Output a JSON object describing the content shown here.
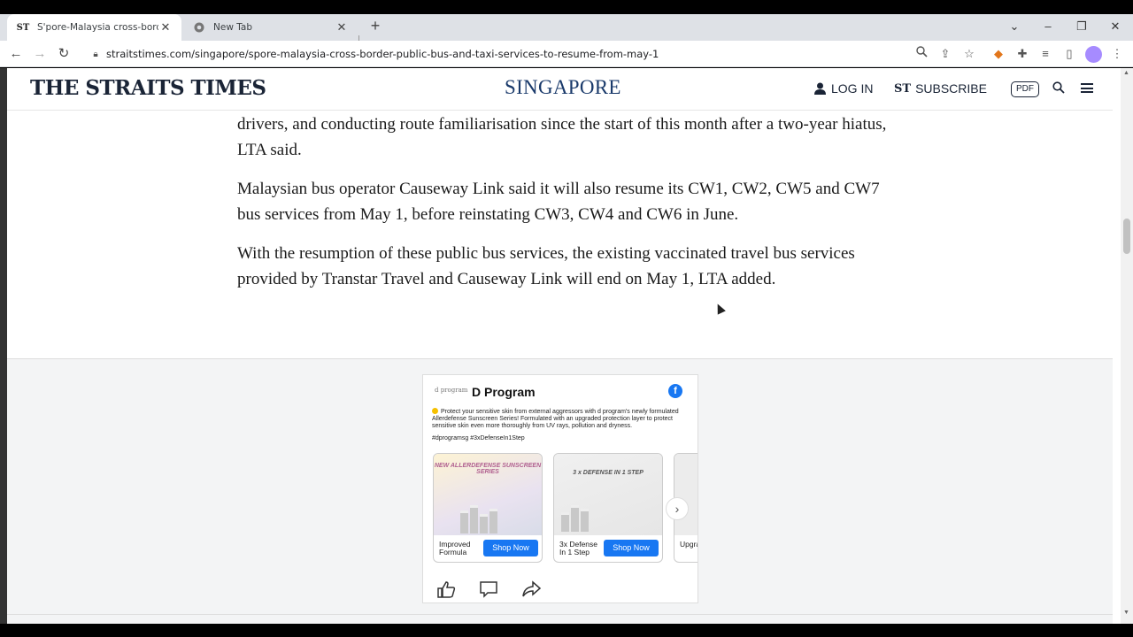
{
  "browser": {
    "tabs": [
      {
        "label": "S'pore-Malaysia cross-border pu",
        "favicon": "ST",
        "active": true
      },
      {
        "label": "New Tab",
        "favicon": "chrome-icon",
        "active": false
      }
    ],
    "url": "straitstimes.com/singapore/spore-malaysia-cross-border-public-bus-and-taxi-services-to-resume-from-may-1"
  },
  "site": {
    "logo": "THE STRAITS TIMES",
    "section": "SINGAPORE",
    "login": "LOG IN",
    "subscribe": "SUBSCRIBE",
    "subscribe_mark": "ST",
    "pdf": "PDF"
  },
  "article": {
    "paragraphs": [
      "drivers, and conducting route familiarisation since the start of this month after a two-year hiatus, LTA said.",
      "Malaysian bus operator Causeway Link said it will also resume its CW1, CW2, CW5 and CW7 bus services from May 1, before reinstating CW3, CW4 and CW6 in June.",
      "With the resumption of these public bus services, the existing vaccinated travel bus services provided by Transtar Travel and Causeway Link will end on May 1, LTA added."
    ]
  },
  "ad": {
    "brand_logo": "d program",
    "brand": "D Program",
    "text": "Protect your sensitive skin from external aggressors with d program's newly formulated Allerdefense Sunscreen Series! Formulated with an upgraded protection layer to protect sensitive skin even more thoroughly from UV rays, pollution and dryness.",
    "hashtags": "#dprogramsg #3xDefenseIn1Step",
    "cards": [
      {
        "caption": "NEW ALLERDEFENSE SUNSCREEN SERIES",
        "label": "Improved Formula",
        "button": "Shop Now"
      },
      {
        "caption": "3 x DEFENSE IN 1 STEP",
        "label": "3x Defense In 1 Step",
        "button": "Shop Now"
      },
      {
        "caption": "",
        "label": "Upgra Bene",
        "button": ""
      }
    ]
  }
}
